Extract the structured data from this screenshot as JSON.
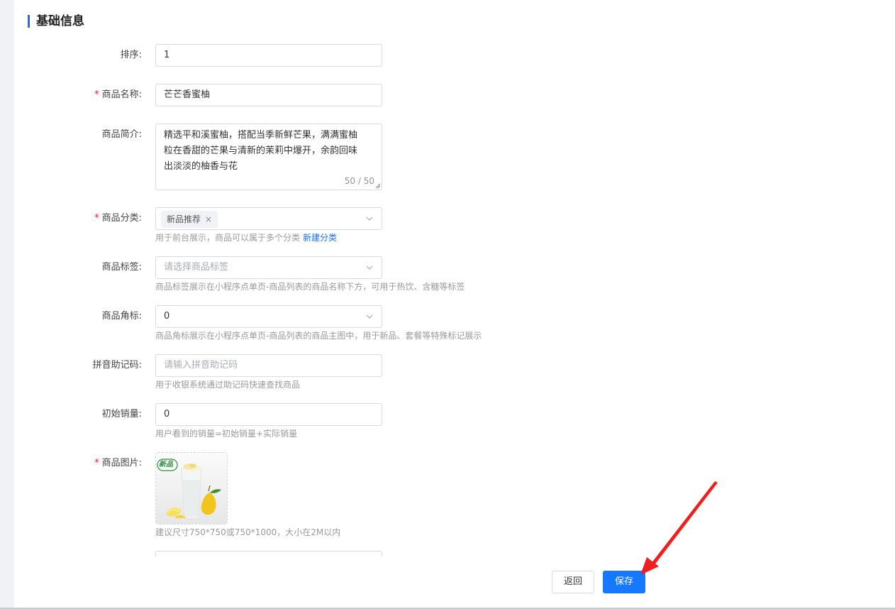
{
  "section": {
    "title": "基础信息"
  },
  "form": {
    "sort": {
      "label": "排序:",
      "value": "1"
    },
    "name": {
      "label": "商品名称:",
      "required_mark": "*",
      "value": "芒芒香蜜柚"
    },
    "intro": {
      "label": "商品简介:",
      "value": "精选平和溪蜜柚，搭配当季新鲜芒果，满满蜜柚\n粒在香甜的芒果与清新的茉莉中爆开，余韵回味\n出淡淡的柚香与花",
      "counter": "50 / 50"
    },
    "category": {
      "label": "商品分类:",
      "required_mark": "*",
      "tag": "新品推荐",
      "tag_close": "×",
      "hint": "用于前台展示，商品可以属于多个分类",
      "hint_link": "新建分类"
    },
    "tags": {
      "label": "商品标签:",
      "placeholder": "请选择商品标签",
      "hint": "商品标签展示在小程序点单页-商品列表的商品名称下方，可用于热饮、含糖等标签"
    },
    "corner": {
      "label": "商品角标:",
      "value": "0",
      "hint": "商品角标展示在小程序点单页-商品列表的商品主图中，用于新品、套餐等特殊标记展示"
    },
    "pinyin": {
      "label": "拼音助记码:",
      "placeholder": "请输入拼音助记码",
      "hint": "用于收银系统通过助记码快速查找商品"
    },
    "initial_sales": {
      "label": "初始销量:",
      "value": "0",
      "hint": "用户看到的销量=初始销量+实际销量"
    },
    "image": {
      "label": "商品图片:",
      "required_mark": "*",
      "badge": "新品",
      "hint": "建议尺寸750*750或750*1000，大小在2M以内"
    }
  },
  "footer": {
    "back_label": "返回",
    "save_label": "保存"
  },
  "colors": {
    "primary": "#1677ff",
    "required": "#f5222d",
    "arrow": "#f01e1e"
  },
  "icons": {
    "select": "chevron-down-icon",
    "tag_close": "close-icon",
    "annotation": "red-arrow-icon"
  }
}
